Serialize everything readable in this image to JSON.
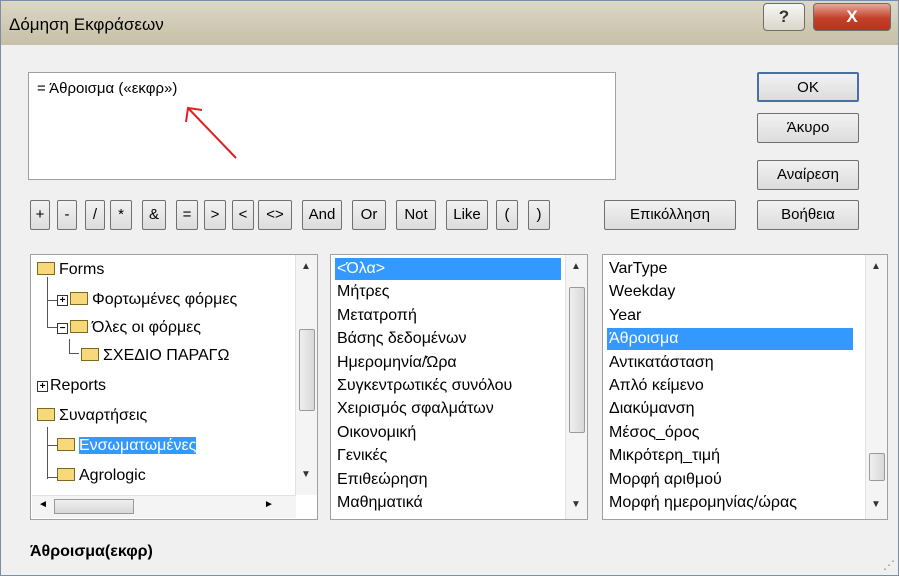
{
  "window": {
    "title": "Δόμηση Εκφράσεων",
    "help_label": "?",
    "close_label": "X"
  },
  "expression": {
    "text": "= Άθροισμα («εκφρ»)"
  },
  "buttons": {
    "ok": "OK",
    "cancel": "Άκυρο",
    "undo": "Αναίρεση",
    "help": "Βοήθεια",
    "paste": "Επικόλληση"
  },
  "operators": [
    "+",
    "-",
    "/",
    "*",
    "&",
    "=",
    ">",
    "<",
    "<>",
    "And",
    "Or",
    "Not",
    "Like",
    "(",
    ")"
  ],
  "tree": {
    "forms": "Forms",
    "loaded_forms": "Φορτωμένες φόρμες",
    "all_forms": "Όλες οι φόρμες",
    "design_form": "ΣΧΕΔΙΟ ΠΑΡΑΓΩ",
    "reports": "Reports",
    "functions": "Συναρτήσεις",
    "builtin": "Ενσωματωμένες",
    "agrologic": "Agrologic",
    "expand_plus": "+",
    "expand_minus": "−"
  },
  "categories": [
    "<Όλα>",
    "Μήτρες",
    "Μετατροπή",
    "Βάσης δεδομένων",
    "Ημερομηνία/Ώρα",
    "Συγκεντρωτικές συνόλου",
    "Χειρισμός σφαλμάτων",
    "Οικονομική",
    "Γενικές",
    "Επιθεώρηση",
    "Μαθηματικά"
  ],
  "functions": [
    "VarType",
    "Weekday",
    "Year",
    "Άθροισμα",
    "Αντικατάσταση",
    "Απλό κείμενο",
    "Διακύμανση",
    "Μέσος_όρος",
    "Μικρότερη_τιμή",
    "Μορφή αριθμού",
    "Μορφή ημερομηνίας/ώρας"
  ],
  "status": {
    "syntax": "Άθροισμα(εκφρ)"
  },
  "colors": {
    "selection": "#3399ff",
    "arrow": "#e02020"
  }
}
